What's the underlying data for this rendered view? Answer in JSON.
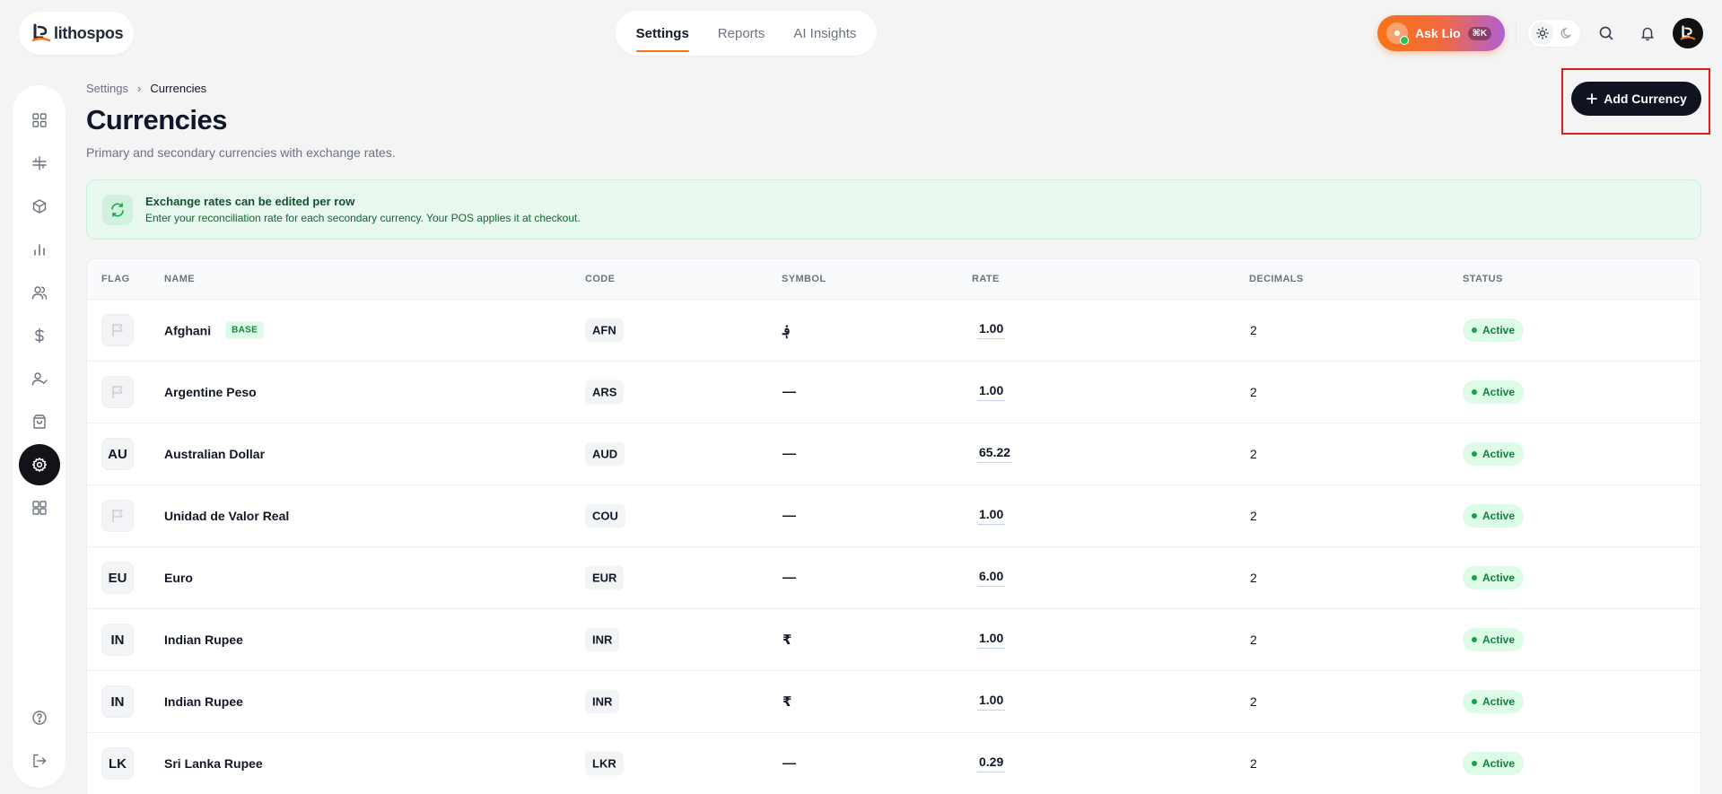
{
  "brand": {
    "name": "lithospos"
  },
  "top_nav": {
    "tabs": [
      {
        "label": "Settings",
        "active": true
      },
      {
        "label": "Reports",
        "active": false
      },
      {
        "label": "AI Insights",
        "active": false
      }
    ]
  },
  "header_actions": {
    "ask_lio_label": "Ask Lio",
    "ask_lio_shortcut": "⌘K",
    "icons": [
      "sun-icon",
      "moon-icon",
      "search-icon",
      "bell-icon",
      "avatar"
    ]
  },
  "sidebar": {
    "items": [
      {
        "icon": "grid-icon"
      },
      {
        "icon": "pos-terminal-icon"
      },
      {
        "icon": "box-icon"
      },
      {
        "icon": "bar-chart-icon"
      },
      {
        "icon": "users-icon"
      },
      {
        "icon": "dollar-icon"
      },
      {
        "icon": "user-check-icon"
      },
      {
        "icon": "shopping-bag-icon"
      },
      {
        "icon": "settings-icon",
        "active": true
      },
      {
        "icon": "apps-icon"
      }
    ],
    "bottom": [
      {
        "icon": "help-icon"
      },
      {
        "icon": "logout-icon"
      }
    ]
  },
  "breadcrumb": {
    "parent": "Settings",
    "separator": "›",
    "current": "Currencies"
  },
  "page": {
    "title": "Currencies",
    "subtitle": "Primary and secondary currencies with exchange rates.",
    "add_button_label": "Add Currency"
  },
  "notice": {
    "title": "Exchange rates can be edited per row",
    "description": "Enter your reconciliation rate for each secondary currency. Your POS applies it at checkout."
  },
  "table": {
    "headers": [
      "FLAG",
      "NAME",
      "CODE",
      "SYMBOL",
      "RATE",
      "DECIMALS",
      "STATUS"
    ],
    "rows": [
      {
        "flag": "",
        "name": "Afghani",
        "badge": "BASE",
        "code": "AFN",
        "symbol": "؋",
        "rate": "1.00",
        "decimals": "2",
        "status": "Active"
      },
      {
        "flag": "",
        "name": "Argentine Peso",
        "badge": "",
        "code": "ARS",
        "symbol": "—",
        "rate": "1.00",
        "decimals": "2",
        "status": "Active"
      },
      {
        "flag": "AU",
        "name": "Australian Dollar",
        "badge": "",
        "code": "AUD",
        "symbol": "—",
        "rate": "65.22",
        "decimals": "2",
        "status": "Active"
      },
      {
        "flag": "",
        "name": "Unidad de Valor Real",
        "badge": "",
        "code": "COU",
        "symbol": "—",
        "rate": "1.00",
        "decimals": "2",
        "status": "Active"
      },
      {
        "flag": "EU",
        "name": "Euro",
        "badge": "",
        "code": "EUR",
        "symbol": "—",
        "rate": "6.00",
        "decimals": "2",
        "status": "Active"
      },
      {
        "flag": "IN",
        "name": "Indian Rupee",
        "badge": "",
        "code": "INR",
        "symbol": "₹",
        "rate": "1.00",
        "decimals": "2",
        "status": "Active"
      },
      {
        "flag": "IN",
        "name": "Indian Rupee",
        "badge": "",
        "code": "INR",
        "symbol": "₹",
        "rate": "1.00",
        "decimals": "2",
        "status": "Active"
      },
      {
        "flag": "LK",
        "name": "Sri Lanka Rupee",
        "badge": "",
        "code": "LKR",
        "symbol": "—",
        "rate": "0.29",
        "decimals": "2",
        "status": "Active"
      }
    ]
  }
}
